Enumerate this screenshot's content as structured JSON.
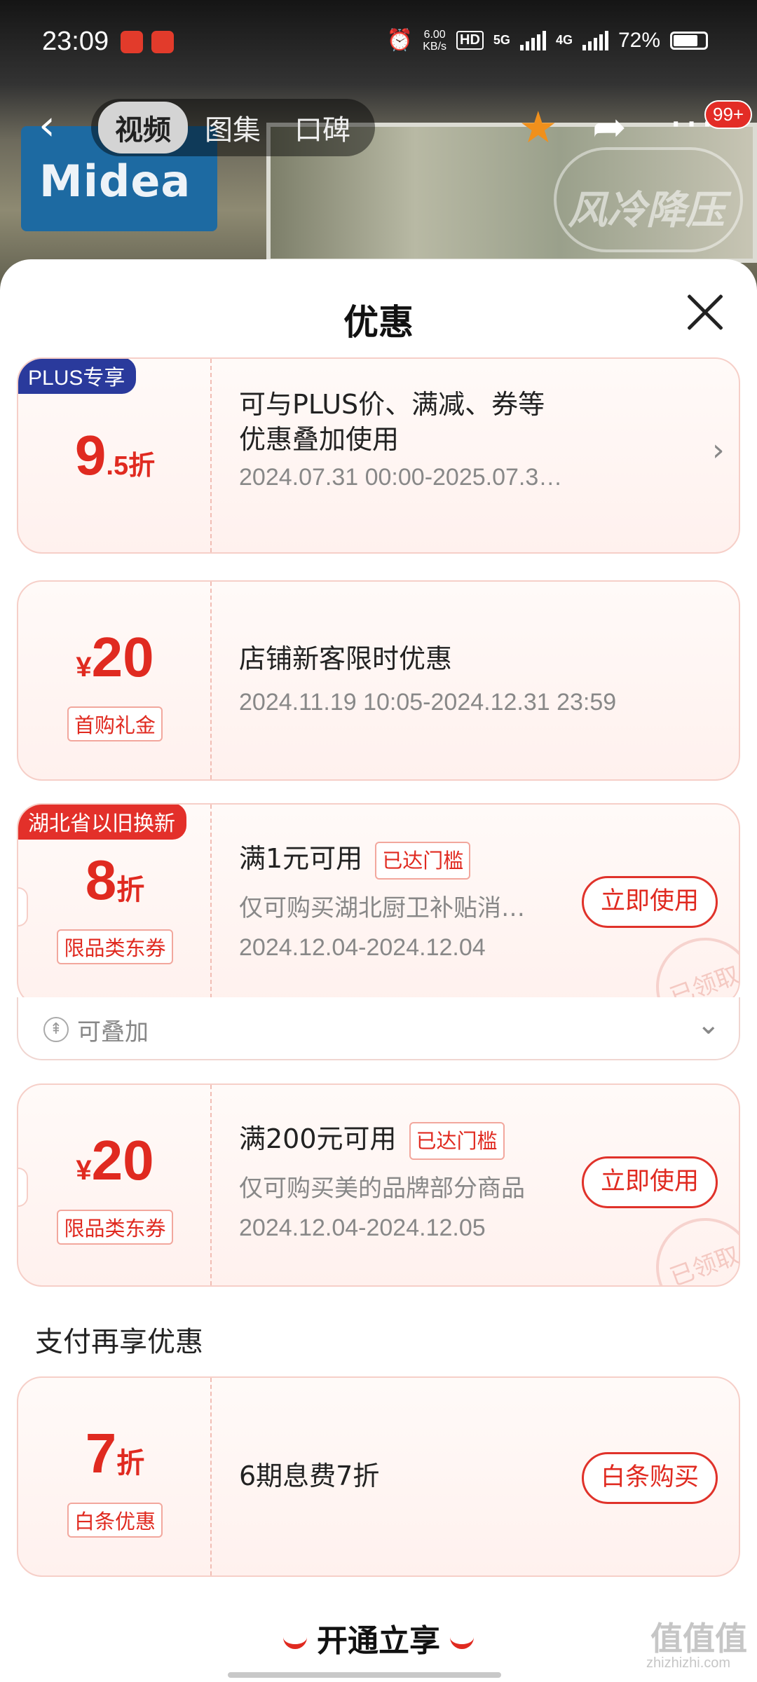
{
  "status_bar": {
    "time": "23:09",
    "net_speed_value": "6.00",
    "net_speed_unit": "KB/s",
    "hd": "HD",
    "net1": "5G",
    "net2": "4G",
    "battery": "72%"
  },
  "nav": {
    "tabs": [
      "视频",
      "图集",
      "口碑"
    ],
    "active_tab": "视频",
    "badge": "99+"
  },
  "background": {
    "brand_logo": "Midea",
    "badge_text": "风冷降压"
  },
  "sheet": {
    "title": "优惠"
  },
  "coupons": [
    {
      "ribbon": "PLUS专享",
      "value": "9",
      "value_small": ".5折",
      "title_line1": "可与PLUS价、满减、券等",
      "title_line2": "优惠叠加使用",
      "date": "2024.07.31 00:00-2025.07.3…"
    },
    {
      "currency": "¥",
      "value": "20",
      "tag": "首购礼金",
      "title": "店铺新客限时优惠",
      "date": "2024.11.19 10:05-2024.12.31 23:59"
    },
    {
      "ribbon": "湖北省以旧换新",
      "value": "8",
      "unit": "折",
      "tag": "限品类东券",
      "title": "满1元可用",
      "threshold": "已达门槛",
      "desc": "仅可购买湖北厨卫补贴消…",
      "date": "2024.12.04-2024.12.04",
      "button": "立即使用",
      "stamp": "已领取",
      "stackable": "可叠加"
    },
    {
      "currency": "¥",
      "value": "20",
      "tag": "限品类东券",
      "title": "满200元可用",
      "threshold": "已达门槛",
      "desc": "仅可购买美的品牌部分商品",
      "date": "2024.12.04-2024.12.05",
      "button": "立即使用",
      "stamp": "已领取"
    }
  ],
  "payment_section": {
    "title": "支付再享优惠",
    "coupon": {
      "value": "7",
      "unit": "折",
      "tag": "白条优惠",
      "title": "6期息费7折",
      "button": "白条购买"
    }
  },
  "footer": {
    "cta": "开通立享"
  },
  "watermark": {
    "main": "值值值",
    "sub": "zhizhizhi.com"
  },
  "colors": {
    "accent": "#e02a20",
    "plus_ribbon": "#2a3a9c",
    "star": "#f0901c"
  }
}
